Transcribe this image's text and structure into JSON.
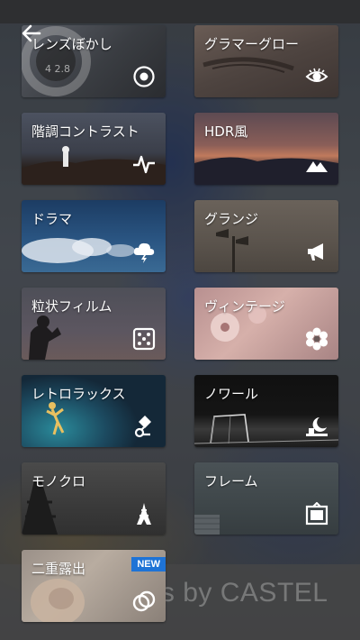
{
  "watermark": "Photos by CASTEL",
  "tiles": [
    {
      "label": "レンズぼかし",
      "icon": "lens-blur-icon"
    },
    {
      "label": "グラマーグロー",
      "icon": "eye-icon"
    },
    {
      "label": "階調コントラスト",
      "icon": "pulse-icon"
    },
    {
      "label": "HDR風",
      "icon": "mountain-icon"
    },
    {
      "label": "ドラマ",
      "icon": "storm-cloud-icon"
    },
    {
      "label": "グランジ",
      "icon": "megaphone-icon"
    },
    {
      "label": "粒状フィルム",
      "icon": "dice-icon"
    },
    {
      "label": "ヴィンテージ",
      "icon": "flower-icon"
    },
    {
      "label": "レトロラックス",
      "icon": "retrolux-icon"
    },
    {
      "label": "ノワール",
      "icon": "moon-horizon-icon"
    },
    {
      "label": "モノクロ",
      "icon": "eiffel-tower-icon"
    },
    {
      "label": "フレーム",
      "icon": "frame-icon"
    },
    {
      "label": "二重露出",
      "icon": "double-exposure-icon",
      "badge": "NEW"
    }
  ]
}
